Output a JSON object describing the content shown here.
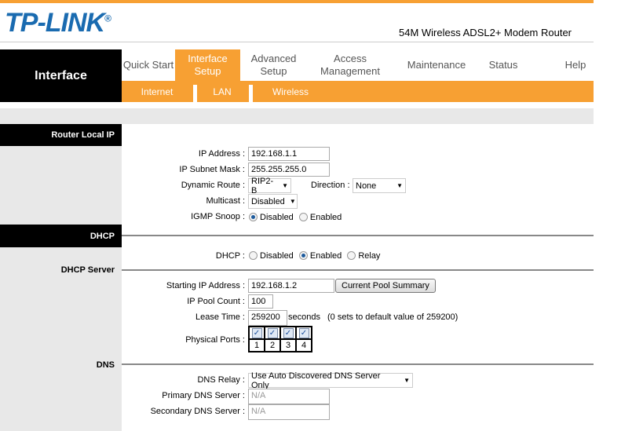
{
  "header": {
    "logo": "TP-LINK",
    "product": "54M Wireless ADSL2+ Modem Router"
  },
  "nav": {
    "section": "Interface",
    "tabs": [
      {
        "label": "Quick Start"
      },
      {
        "label": "Interface Setup"
      },
      {
        "label": "Advanced Setup"
      },
      {
        "label": "Access Management"
      },
      {
        "label": "Maintenance"
      },
      {
        "label": "Status"
      },
      {
        "label": "Help"
      }
    ],
    "subtabs": [
      "Internet",
      "LAN",
      "Wireless"
    ]
  },
  "colors": {
    "accent": "#f7a033",
    "logo": "#1a6bb0"
  },
  "sections": {
    "router_local_ip": "Router Local IP",
    "dhcp": "DHCP",
    "dhcp_server": "DHCP Server",
    "dns": "DNS"
  },
  "router": {
    "ip_label": "IP Address :",
    "ip": "192.168.1.1",
    "mask_label": "IP Subnet Mask :",
    "mask": "255.255.255.0",
    "route_label": "Dynamic Route :",
    "route": "RIP2-B",
    "direction_label": "Direction :",
    "direction": "None",
    "multicast_label": "Multicast :",
    "multicast": "Disabled",
    "igmp_label": "IGMP Snoop :",
    "igmp_options": [
      "Disabled",
      "Enabled"
    ],
    "igmp_selected": "Disabled"
  },
  "dhcp": {
    "label": "DHCP :",
    "options": [
      "Disabled",
      "Enabled",
      "Relay"
    ],
    "selected": "Enabled"
  },
  "dhcp_server": {
    "start_label": "Starting IP Address :",
    "start": "192.168.1.2",
    "pool_button": "Current Pool Summary",
    "count_label": "IP Pool Count :",
    "count": "100",
    "lease_label": "Lease Time :",
    "lease": "259200",
    "lease_unit": "seconds",
    "lease_note": "(0 sets to default value of 259200)",
    "ports_label": "Physical Ports :",
    "ports": [
      "1",
      "2",
      "3",
      "4"
    ],
    "ports_checked": [
      true,
      true,
      true,
      true
    ]
  },
  "dns": {
    "relay_label": "DNS Relay :",
    "relay": "Use Auto Discovered DNS Server Only",
    "primary_label": "Primary DNS Server :",
    "primary": "N/A",
    "secondary_label": "Secondary DNS Server :",
    "secondary": "N/A"
  }
}
